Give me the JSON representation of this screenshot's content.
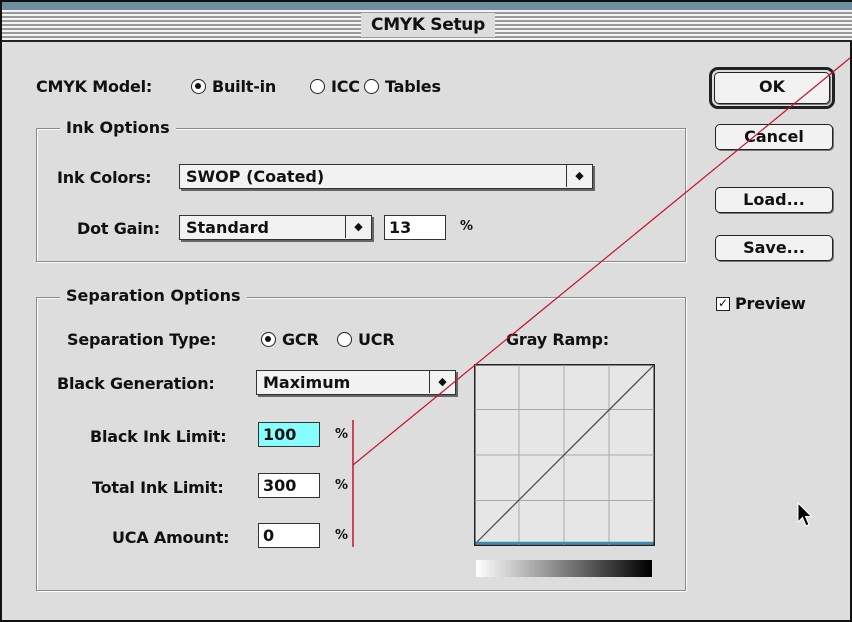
{
  "window": {
    "title": "CMYK Setup"
  },
  "cmyk_model": {
    "label": "CMYK Model:",
    "options": [
      "Built-in",
      "ICC",
      "Tables"
    ],
    "selected": "Built-in"
  },
  "ink_options": {
    "title": "Ink Options",
    "ink_colors_label": "Ink Colors:",
    "ink_colors_value": "SWOP (Coated)",
    "dot_gain_label": "Dot Gain:",
    "dot_gain_value": "Standard",
    "dot_gain_amount": "13",
    "percent": "%"
  },
  "separation_options": {
    "title": "Separation Options",
    "type_label": "Separation Type:",
    "types": [
      "GCR",
      "UCR"
    ],
    "selected_type": "GCR",
    "black_generation_label": "Black Generation:",
    "black_generation_value": "Maximum",
    "black_ink_limit_label": "Black Ink Limit:",
    "black_ink_limit_value": "100",
    "total_ink_limit_label": "Total Ink Limit:",
    "total_ink_limit_value": "300",
    "uca_amount_label": "UCA Amount:",
    "uca_amount_value": "0",
    "percent": "%",
    "gray_ramp_label": "Gray Ramp:"
  },
  "buttons": {
    "ok": "OK",
    "cancel": "Cancel",
    "load": "Load...",
    "save": "Save..."
  },
  "preview": {
    "label": "Preview",
    "checked": true
  },
  "colors": {
    "highlight_field": "#88ffff",
    "annotation_line": "#c8102e",
    "ramp_baseline": "#3a8fb0"
  },
  "icons": {
    "popup_arrow": "updown-arrow-icon",
    "cursor": "arrow-cursor-icon"
  }
}
